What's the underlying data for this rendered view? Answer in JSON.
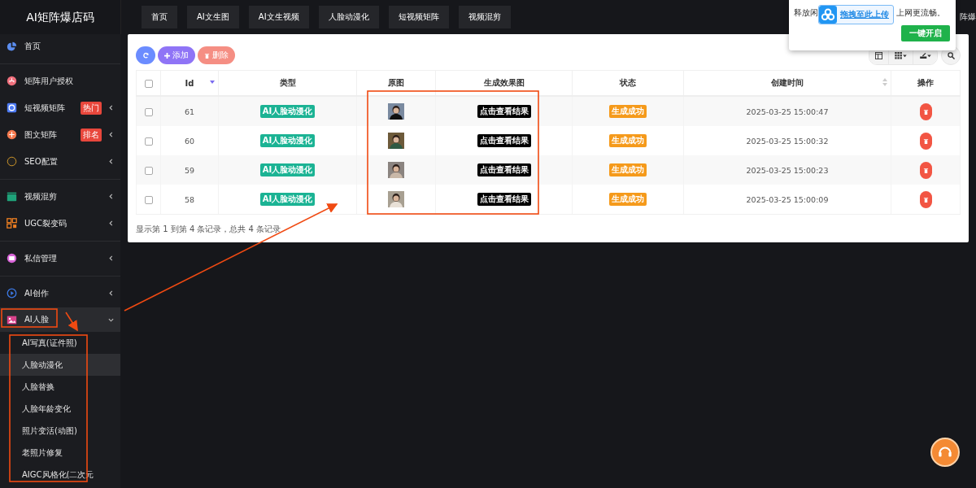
{
  "brand": "AI矩阵爆店码",
  "top_nav": [
    "首页",
    "AI文生图",
    "AI文生视频",
    "人脸动漫化",
    "短视频矩阵",
    "视频混剪"
  ],
  "top_right_cut": "阵爆",
  "sidebar": {
    "groups": [
      [
        {
          "label": "首页",
          "expandable": false,
          "expanded": false
        }
      ],
      [
        {
          "label": "矩阵用户授权",
          "expandable": false,
          "expanded": false
        },
        {
          "label": "短视频矩阵",
          "badge": "热门",
          "expandable": true,
          "expanded": false
        },
        {
          "label": "图文矩阵",
          "badge": "排名",
          "expandable": true,
          "expanded": false
        },
        {
          "label": "SEO配置",
          "expandable": true,
          "expanded": false
        }
      ],
      [
        {
          "label": "视频混剪",
          "expandable": true,
          "expanded": false
        },
        {
          "label": "UGC裂变码",
          "expandable": true,
          "expanded": false
        }
      ],
      [
        {
          "label": "私信管理",
          "expandable": true,
          "expanded": false
        }
      ],
      [
        {
          "label": "AI创作",
          "expandable": true,
          "expanded": false
        },
        {
          "label": "AI人脸",
          "expandable": true,
          "expanded": true,
          "children": [
            {
              "label": "AI写真(证件照)",
              "selected": false
            },
            {
              "label": "人脸动漫化",
              "selected": true
            },
            {
              "label": "人脸替换",
              "selected": false
            },
            {
              "label": "人脸年龄变化",
              "selected": false
            },
            {
              "label": "照片变活(动图)",
              "selected": false
            },
            {
              "label": "老照片修复",
              "selected": false
            },
            {
              "label": "AIGC风格化(二次元",
              "selected": false
            }
          ]
        }
      ]
    ]
  },
  "toolbar": {
    "add": "添加",
    "delete": "删除"
  },
  "table": {
    "select_all_checked": false,
    "columns": [
      "Id",
      "类型",
      "原图",
      "生成效果图",
      "状态",
      "创建时间",
      "操作"
    ],
    "rows": [
      {
        "checked": false,
        "id": "61",
        "type": "AI人脸动漫化",
        "result": "点击查看结果",
        "status": "生成成功",
        "created": "2025-03-25 15:00:47"
      },
      {
        "checked": false,
        "id": "60",
        "type": "AI人脸动漫化",
        "result": "点击查看结果",
        "status": "生成成功",
        "created": "2025-03-25 15:00:32"
      },
      {
        "checked": false,
        "id": "59",
        "type": "AI人脸动漫化",
        "result": "点击查看结果",
        "status": "生成成功",
        "created": "2025-03-25 15:00:23"
      },
      {
        "checked": false,
        "id": "58",
        "type": "AI人脸动漫化",
        "result": "点击查看结果",
        "status": "生成成功",
        "created": "2025-03-25 15:00:09"
      }
    ],
    "summary": "显示第 1 到第 4 条记录，总共 4 条记录"
  },
  "popup": {
    "text_start": "释放闲",
    "text_end": "上网更流畅。",
    "upload_chip": "拖拽至此上传",
    "button": "一键开启"
  }
}
